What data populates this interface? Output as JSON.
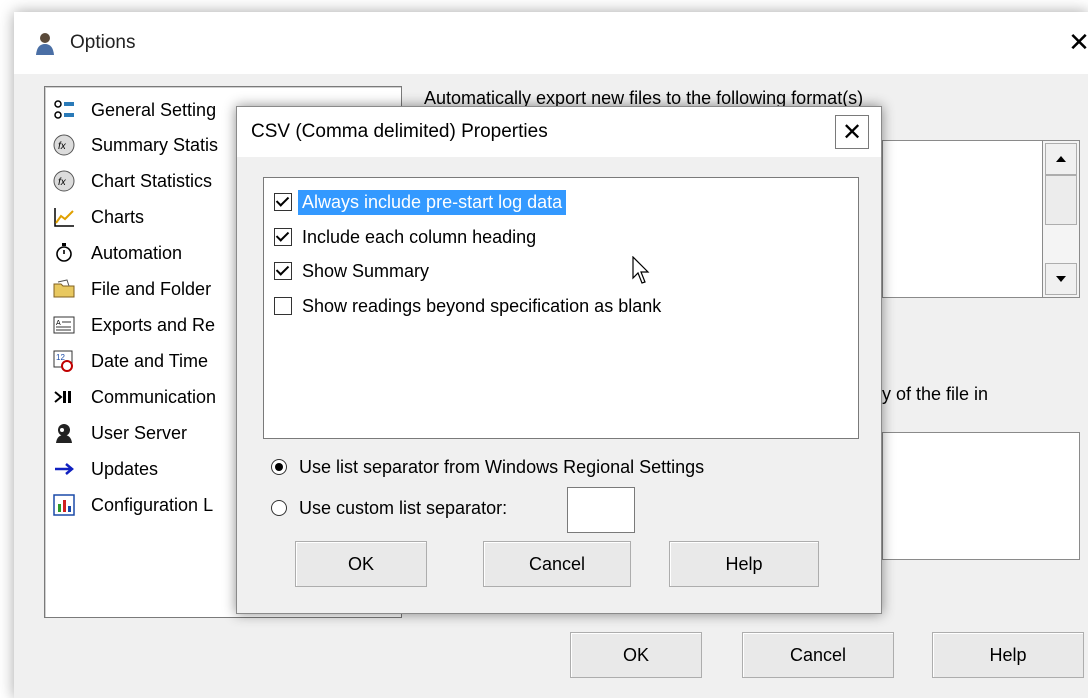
{
  "options_window": {
    "title": "Options",
    "close_glyph": "✕",
    "categories": [
      {
        "label": "General Setting",
        "icon": "general-settings-icon"
      },
      {
        "label": "Summary Statis",
        "icon": "summary-statistics-icon"
      },
      {
        "label": "Chart Statistics",
        "icon": "chart-statistics-icon"
      },
      {
        "label": "Charts",
        "icon": "line-chart-icon"
      },
      {
        "label": "Automation",
        "icon": "stopwatch-icon"
      },
      {
        "label": "File and Folder",
        "icon": "folder-icon"
      },
      {
        "label": "Exports and Re",
        "icon": "export-icon"
      },
      {
        "label": "Date and Time",
        "icon": "calendar-clock-icon"
      },
      {
        "label": "Communication",
        "icon": "communication-icon"
      },
      {
        "label": "User Server",
        "icon": "user-server-icon"
      },
      {
        "label": "Updates",
        "icon": "arrow-right-icon"
      },
      {
        "label": "Configuration L",
        "icon": "configuration-icon"
      }
    ],
    "auto_export_label": "Automatically export new files to the following format(s)",
    "copy_label": "y of the file in",
    "buttons": {
      "ok": "OK",
      "cancel": "Cancel",
      "help": "Help"
    }
  },
  "csv_dialog": {
    "title": "CSV (Comma delimited) Properties",
    "close_glyph": "✕",
    "options": [
      {
        "label": "Always include pre-start log data",
        "checked": true,
        "selected": true
      },
      {
        "label": "Include each column heading",
        "checked": true,
        "selected": false
      },
      {
        "label": "Show Summary",
        "checked": true,
        "selected": false
      },
      {
        "label": "Show readings beyond specification as blank",
        "checked": false,
        "selected": false
      }
    ],
    "radio_windows_separator": "Use list separator from Windows Regional Settings",
    "radio_custom_separator": "Use custom list separator:",
    "custom_separator_value": "",
    "selected_radio": "windows",
    "buttons": {
      "ok": "OK",
      "cancel": "Cancel",
      "help": "Help"
    }
  },
  "colors": {
    "selection": "#3399ff",
    "window_bg": "#f0f0f0"
  }
}
